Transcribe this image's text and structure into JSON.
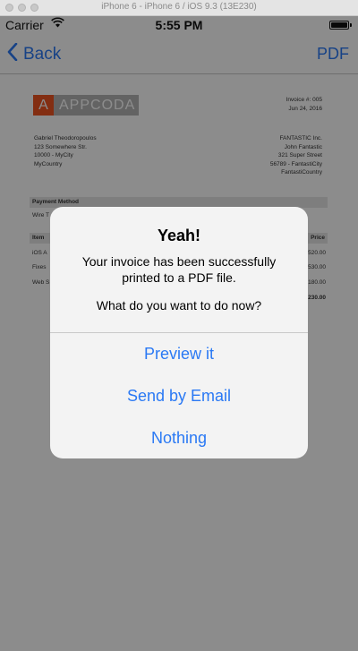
{
  "window": {
    "title": "iPhone 6 - iPhone 6 / iOS 9.3 (13E230)"
  },
  "status_bar": {
    "carrier": "Carrier",
    "time": "5:55 PM"
  },
  "nav": {
    "back_label": "Back",
    "pdf_label": "PDF"
  },
  "invoice": {
    "logo_letter": "A",
    "logo_text": "APPCODA",
    "number": "Invoice #: 005",
    "date": "Jun 24, 2016",
    "from": [
      "Gabriel Theodoropoulos",
      "123 Somewhere Str.",
      "10000 - MyCity",
      "MyCountry"
    ],
    "to": [
      "FANTASTIC Inc.",
      "John Fantastic",
      "321 Super Street",
      "56789 - FantastiCity",
      "FantastiCountry"
    ],
    "payment_header": "Payment Method",
    "payment_value": "Wire T",
    "item_header": "Item",
    "price_header": "Price",
    "items": [
      {
        "name": "iOS A",
        "price": "520.00"
      },
      {
        "name": "Fixes",
        "price": "530.00"
      },
      {
        "name": "Web S",
        "price": "180.00"
      }
    ],
    "total": "230.00"
  },
  "alert": {
    "title": "Yeah!",
    "message": "Your invoice has been successfully\nprinted to a PDF file.",
    "question": "What do you want to do now?",
    "buttons": {
      "preview": "Preview it",
      "email": "Send by Email",
      "nothing": "Nothing"
    }
  },
  "colors": {
    "accent": "#2a79f4",
    "logo": "#ee5522"
  }
}
